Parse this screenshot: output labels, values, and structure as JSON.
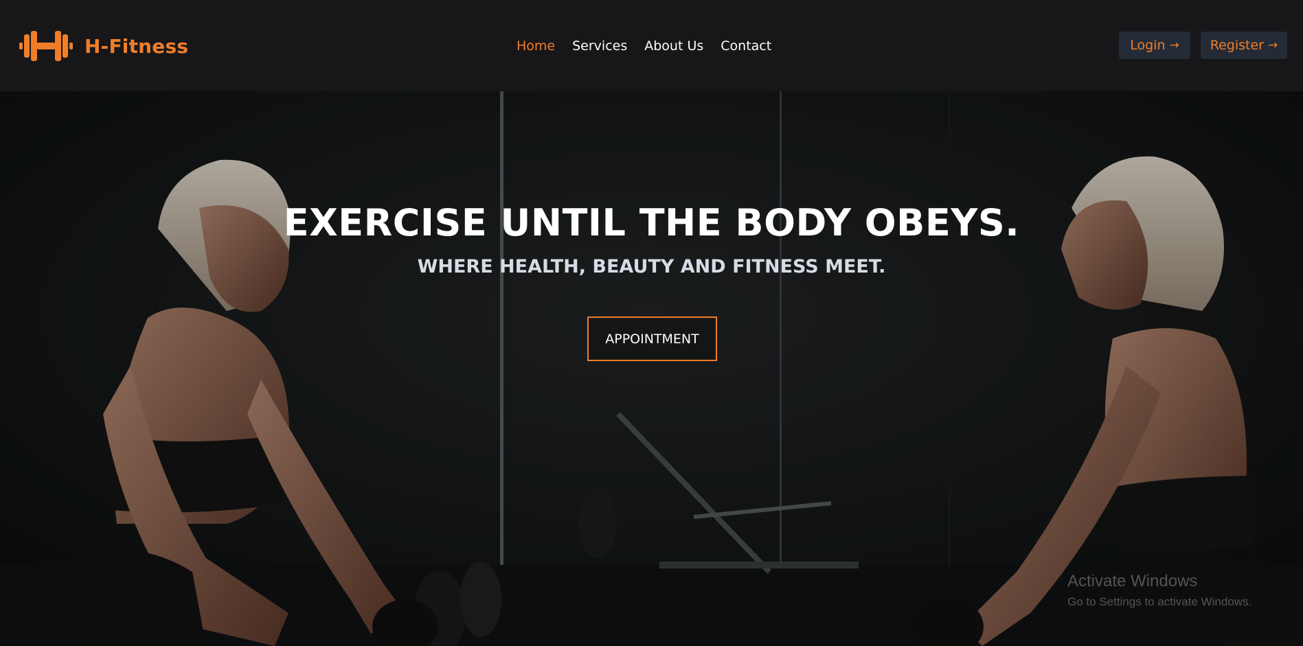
{
  "brand": {
    "name": "H-Fitness",
    "icon": "dumbbell-icon",
    "color": "#f07e29"
  },
  "nav": {
    "items": [
      {
        "label": "Home",
        "active": true
      },
      {
        "label": "Services",
        "active": false
      },
      {
        "label": "About Us",
        "active": false
      },
      {
        "label": "Contact",
        "active": false
      }
    ]
  },
  "auth": {
    "login_label": "Login",
    "register_label": "Register",
    "arrow_icon": "arrow-right-icon"
  },
  "hero": {
    "title": "EXERCISE UNTIL THE BODY OBEYS.",
    "subtitle": "WHERE HEALTH, BEAUTY AND FITNESS MEET.",
    "cta_label": "APPOINTMENT",
    "background": "gym-photo-woman-mirror"
  },
  "watermark": {
    "title": "Activate Windows",
    "subtitle": "Go to Settings to activate Windows."
  },
  "colors": {
    "accent": "#f07e29",
    "nav_bg": "#171719",
    "button_bg": "#252b36"
  }
}
